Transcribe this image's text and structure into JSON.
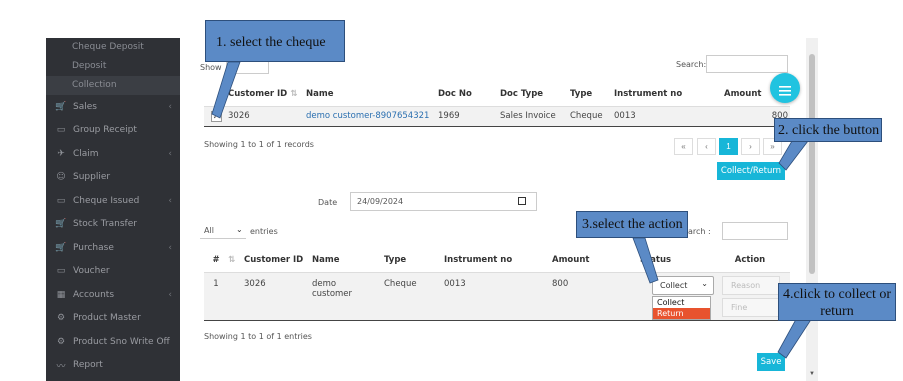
{
  "sidebar": {
    "sub_items": [
      "Cheque Deposit",
      "Deposit",
      "Collection"
    ],
    "items": [
      {
        "label": "Sales",
        "icon": "cart-icon",
        "chevron": true
      },
      {
        "label": "Group Receipt",
        "icon": "receipt-icon",
        "chevron": false
      },
      {
        "label": "Claim",
        "icon": "pin-icon",
        "chevron": true
      },
      {
        "label": "Supplier",
        "icon": "user-icon",
        "chevron": false
      },
      {
        "label": "Cheque Issued",
        "icon": "receipt-icon",
        "chevron": true
      },
      {
        "label": "Stock Transfer",
        "icon": "cart-icon",
        "chevron": false
      },
      {
        "label": "Purchase",
        "icon": "cart-icon",
        "chevron": true
      },
      {
        "label": "Voucher",
        "icon": "receipt-icon",
        "chevron": false
      },
      {
        "label": "Accounts",
        "icon": "grid-icon",
        "chevron": true
      },
      {
        "label": "Product Master",
        "icon": "gear-icon",
        "chevron": false
      },
      {
        "label": "Product Sno Write Off",
        "icon": "gear-icon",
        "chevron": false
      },
      {
        "label": "Report",
        "icon": "chart-icon",
        "chevron": false
      }
    ]
  },
  "top": {
    "show_label": "Show",
    "search_label": "Search:",
    "columns": [
      "Customer ID",
      "Name",
      "Doc No",
      "Doc Type",
      "Type",
      "Instrument no",
      "Amount"
    ],
    "row": {
      "customer_id": "3026",
      "name": "demo customer-8907654321",
      "doc_no": "1969",
      "doc_type": "Sales Invoice",
      "type": "Cheque",
      "instrument_no": "0013",
      "amount": "800"
    },
    "info": "Showing 1 to 1 of 1 records",
    "pager": [
      "«",
      "‹",
      "1",
      "›",
      "»"
    ],
    "collect_return_button": "Collect/Return",
    "fab_icon": "menu-icon"
  },
  "bottom": {
    "date_label": "Date",
    "date_value": "24/09/2024",
    "entries_select": "All",
    "entries_label": "entries",
    "search_label": "Search :",
    "columns": [
      "#",
      "Customer ID",
      "Name",
      "Type",
      "Instrument no",
      "Amount",
      "Status",
      "Action"
    ],
    "row": {
      "index": "1",
      "customer_id": "3026",
      "name_line1": "demo",
      "name_line2": "customer",
      "type": "Cheque",
      "instrument_no": "0013",
      "amount": "800"
    },
    "status_selected": "Collect",
    "status_options": [
      "Collect",
      "Return"
    ],
    "reason_placeholder": "Reason",
    "fine_placeholder": "Fine",
    "info": "Showing 1 to 1 of 1 entries",
    "save_button": "Save"
  },
  "callouts": {
    "step1": "1. select the cheque",
    "step2": "2. click the button",
    "step3": "3.select the action",
    "step4_line1": "4.click to collect or",
    "step4_line2": "return"
  }
}
